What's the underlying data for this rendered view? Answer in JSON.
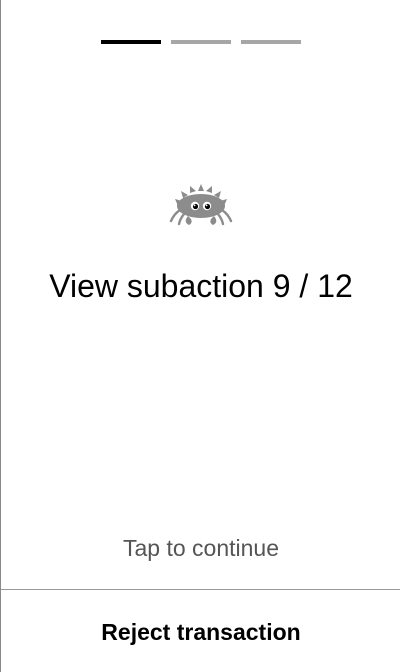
{
  "progress": {
    "steps": 3,
    "current": 1
  },
  "mascot": {
    "icon": "crab-mascot-icon",
    "color": "#8c8c8c"
  },
  "main": {
    "title": "View subaction 9 / 12",
    "hint": "Tap to continue"
  },
  "footer": {
    "reject_label": "Reject transaction"
  },
  "colors": {
    "active_step": "#000000",
    "inactive_step": "#a6a6a6",
    "hint_text": "#555555"
  }
}
